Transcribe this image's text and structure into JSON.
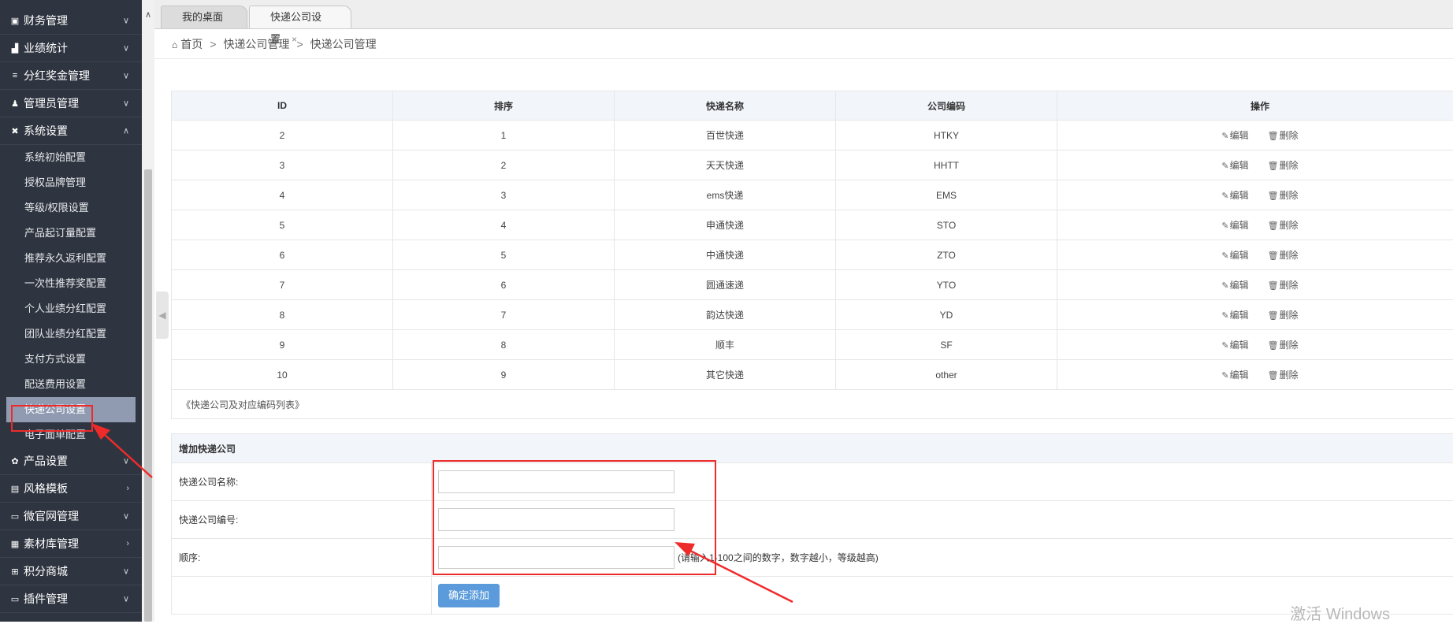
{
  "sidebar": {
    "menus_top": [
      {
        "icon": "ledger-icon",
        "glyph": "▣",
        "label": "财务管理",
        "chev": "∨"
      },
      {
        "icon": "bar-chart-icon",
        "glyph": "▟",
        "label": "业绩统计",
        "chev": "∨"
      },
      {
        "icon": "database-icon",
        "glyph": "≡",
        "label": "分红奖金管理",
        "chev": "∨"
      },
      {
        "icon": "user-group-icon",
        "glyph": "♟",
        "label": "管理员管理",
        "chev": "∨"
      },
      {
        "icon": "wrench-icon",
        "glyph": "✖",
        "label": "系统设置",
        "chev": "∧"
      }
    ],
    "sub_items": [
      "系统初始配置",
      "授权品牌管理",
      "等级/权限设置",
      "产品起订量配置",
      "推荐永久返利配置",
      "一次性推荐奖配置",
      "个人业绩分红配置",
      "团队业绩分红配置",
      "支付方式设置",
      "配送费用设置",
      "快递公司设置",
      "电子面单配置"
    ],
    "active_sub": "快递公司设置",
    "menus_bottom": [
      {
        "icon": "gear-icon",
        "glyph": "✿",
        "label": "产品设置",
        "chev": "∨"
      },
      {
        "icon": "layout-icon",
        "glyph": "▤",
        "label": "风格模板",
        "chev": "›"
      },
      {
        "icon": "window-icon",
        "glyph": "▭",
        "label": "微官网管理",
        "chev": "∨"
      },
      {
        "icon": "library-icon",
        "glyph": "▦",
        "label": "素材库管理",
        "chev": "›"
      },
      {
        "icon": "shop-icon",
        "glyph": "⊞",
        "label": "积分商城",
        "chev": "∨"
      },
      {
        "icon": "plugin-icon",
        "glyph": "▭",
        "label": "插件管理",
        "chev": "∨"
      }
    ]
  },
  "tabs": [
    {
      "label": "我的桌面"
    },
    {
      "label": "快递公司设置",
      "close": "×"
    }
  ],
  "breadcrumb": {
    "home": "首页",
    "sep": ">",
    "level1": "快递公司管理",
    "level2": "快递公司管理"
  },
  "table": {
    "headers": [
      "ID",
      "排序",
      "快递名称",
      "公司编码",
      "操作"
    ],
    "rows": [
      {
        "id": "2",
        "sort": "1",
        "name": "百世快递",
        "code": "HTKY"
      },
      {
        "id": "3",
        "sort": "2",
        "name": "天天快递",
        "code": "HHTT"
      },
      {
        "id": "4",
        "sort": "3",
        "name": "ems快递",
        "code": "EMS"
      },
      {
        "id": "5",
        "sort": "4",
        "name": "申通快递",
        "code": "STO"
      },
      {
        "id": "6",
        "sort": "5",
        "name": "中通快递",
        "code": "ZTO"
      },
      {
        "id": "7",
        "sort": "6",
        "name": "圆通速递",
        "code": "YTO"
      },
      {
        "id": "8",
        "sort": "7",
        "name": "韵达快递",
        "code": "YD"
      },
      {
        "id": "9",
        "sort": "8",
        "name": "顺丰",
        "code": "SF"
      },
      {
        "id": "10",
        "sort": "9",
        "name": "其它快递",
        "code": "other"
      }
    ],
    "edit_label": "编辑",
    "delete_label": "删除",
    "footer": "《快递公司及对应编码列表》"
  },
  "form": {
    "title": "增加快递公司",
    "name_label": "快递公司名称:",
    "code_label": "快递公司编号:",
    "order_label": "顺序:",
    "order_hint": "(请输入1-100之间的数字，数字越小，等级越高)",
    "submit": "确定添加"
  },
  "watermark": "激活 Windows",
  "colors": {
    "sidebar_bg": "#2f3540",
    "active_bg": "#909bb2",
    "accent_button": "#5b9bdb",
    "annotation_red": "#ee2b2b"
  }
}
